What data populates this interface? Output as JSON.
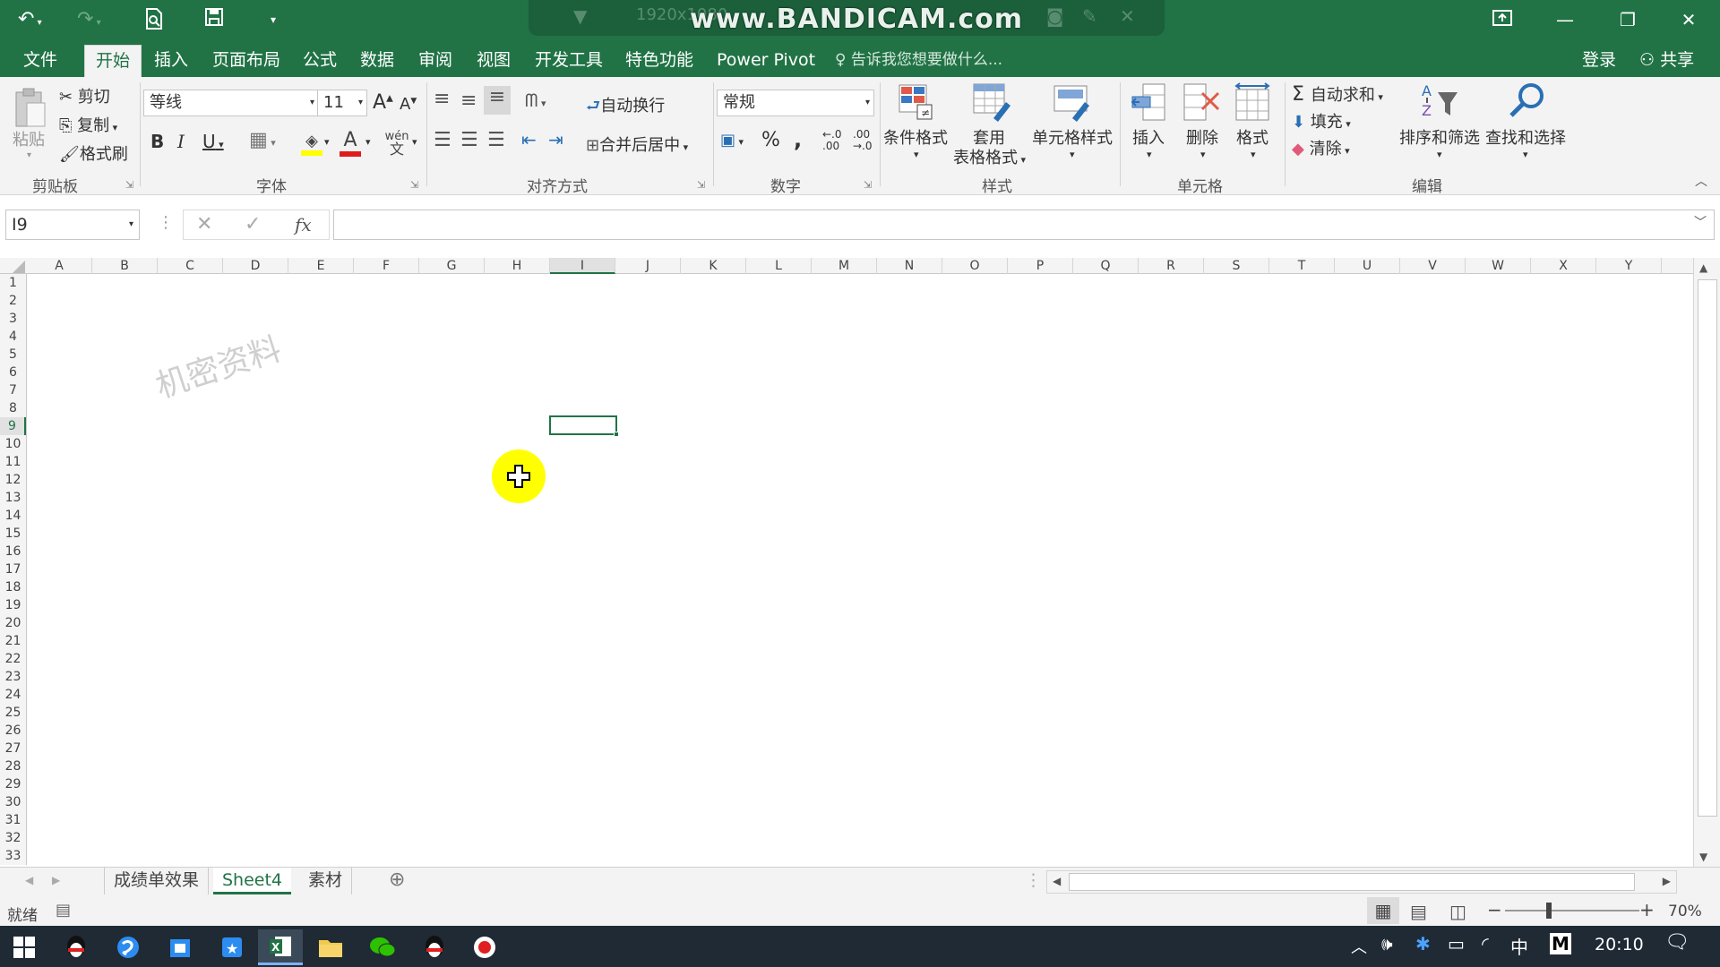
{
  "watermark": {
    "bandicam": "www.BANDICAM.com",
    "resolution": "1920x1080"
  },
  "tabs": [
    {
      "label": "文件",
      "active": false
    },
    {
      "label": "开始",
      "active": true
    },
    {
      "label": "插入",
      "active": false
    },
    {
      "label": "页面布局",
      "active": false
    },
    {
      "label": "公式",
      "active": false
    },
    {
      "label": "数据",
      "active": false
    },
    {
      "label": "审阅",
      "active": false
    },
    {
      "label": "视图",
      "active": false
    },
    {
      "label": "开发工具",
      "active": false
    },
    {
      "label": "特色功能",
      "active": false
    },
    {
      "label": "Power Pivot",
      "active": false
    }
  ],
  "tell_me": "告诉我您想要做什么...",
  "login": "登录",
  "share": "共享",
  "clipboard": {
    "paste": "粘贴",
    "cut": "剪切",
    "copy": "复制",
    "format_painter": "格式刷",
    "group": "剪贴板"
  },
  "font": {
    "name": "等线",
    "size": "11",
    "bold": "B",
    "italic": "I",
    "underline": "U",
    "phonetic_top": "wén",
    "phonetic_bottom": "文",
    "grow": "A",
    "shrink": "A",
    "color_letter": "A",
    "group": "字体"
  },
  "alignment": {
    "wrap": "自动换行",
    "merge": "合并后居中",
    "group": "对齐方式"
  },
  "number": {
    "format": "常规",
    "percent": "%",
    "comma": ",",
    "inc": ".00",
    "dec": ".00",
    "group": "数字"
  },
  "styles": {
    "conditional": "条件格式",
    "table_fmt_line1": "套用",
    "table_fmt_line2": "表格格式",
    "cell_styles": "单元格样式",
    "group": "样式"
  },
  "cells": {
    "insert": "插入",
    "delete": "删除",
    "format": "格式",
    "group": "单元格"
  },
  "editing": {
    "autosum": "自动求和",
    "fill": "填充",
    "clear": "清除",
    "sort": "排序和筛选",
    "find": "查找和选择",
    "group": "编辑"
  },
  "formula_bar": {
    "name_box": "I9",
    "fx": "fx",
    "formula": ""
  },
  "columns": [
    "A",
    "B",
    "C",
    "D",
    "E",
    "F",
    "G",
    "H",
    "I",
    "J",
    "K",
    "L",
    "M",
    "N",
    "O",
    "P",
    "Q",
    "R",
    "S",
    "T",
    "U",
    "V",
    "W",
    "X",
    "Y"
  ],
  "rows": [
    "1",
    "2",
    "3",
    "4",
    "5",
    "6",
    "7",
    "8",
    "9",
    "10",
    "11",
    "12",
    "13",
    "14",
    "15",
    "16",
    "17",
    "18",
    "19",
    "20",
    "21",
    "22",
    "23",
    "24",
    "25",
    "26",
    "27",
    "28",
    "29",
    "30",
    "31",
    "32",
    "33"
  ],
  "selected_cell": "I9",
  "sheet_watermark": "机密资料",
  "sheets": [
    {
      "label": "成绩单效果",
      "active": false
    },
    {
      "label": "Sheet4",
      "active": true
    },
    {
      "label": "素材",
      "active": false
    }
  ],
  "status": {
    "ready": "就绪",
    "zoom": "70%"
  },
  "taskbar": {
    "time": "20:10",
    "ime": "中",
    "m": "M"
  },
  "colors": {
    "brand": "#217346",
    "taskbar": "#1f2a35"
  }
}
